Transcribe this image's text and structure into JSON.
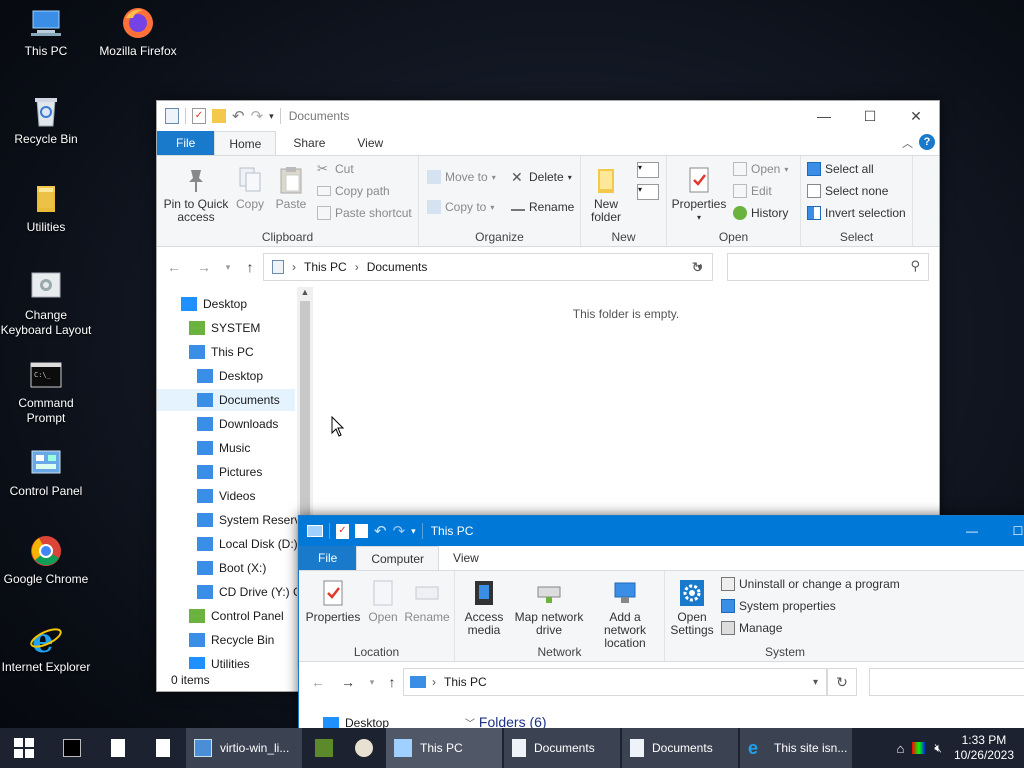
{
  "desktop": {
    "icons": [
      {
        "label": "This PC",
        "icon": "this-pc-icon"
      },
      {
        "label": "Mozilla Firefox",
        "icon": "firefox-icon"
      },
      {
        "label": "Recycle Bin",
        "icon": "recycle-bin-icon"
      },
      {
        "label": "Utilities",
        "icon": "folder-icon"
      },
      {
        "label": "Change Keyboard Layout",
        "icon": "keyboard-icon"
      },
      {
        "label": "Command Prompt",
        "icon": "cmd-icon"
      },
      {
        "label": "Control Panel",
        "icon": "control-panel-icon"
      },
      {
        "label": "Google Chrome",
        "icon": "chrome-icon"
      },
      {
        "label": "Internet Explorer",
        "icon": "ie-icon"
      }
    ]
  },
  "win1": {
    "title": "Documents",
    "tabs": {
      "file": "File",
      "home": "Home",
      "share": "Share",
      "view": "View"
    },
    "clipboard": {
      "pin": "Pin to Quick access",
      "copy": "Copy",
      "paste": "Paste",
      "cut": "Cut",
      "copy_path": "Copy path",
      "paste_shortcut": "Paste shortcut",
      "label": "Clipboard"
    },
    "organize": {
      "move_to": "Move to",
      "copy_to": "Copy to",
      "delete": "Delete",
      "rename": "Rename",
      "label": "Organize"
    },
    "new": {
      "new_folder": "New folder",
      "label": "New"
    },
    "open": {
      "properties": "Properties",
      "open": "Open",
      "edit": "Edit",
      "history": "History",
      "label": "Open"
    },
    "select": {
      "select_all": "Select all",
      "select_none": "Select none",
      "invert": "Invert selection",
      "label": "Select"
    },
    "breadcrumb": [
      "This PC",
      "Documents"
    ],
    "search_placeholder": "",
    "empty_message": "This folder is empty.",
    "status": "0 items",
    "tree": [
      {
        "label": "Desktop",
        "level": 0
      },
      {
        "label": "SYSTEM",
        "level": 1
      },
      {
        "label": "This PC",
        "level": 1
      },
      {
        "label": "Desktop",
        "level": 2
      },
      {
        "label": "Documents",
        "level": 2,
        "selected": true
      },
      {
        "label": "Downloads",
        "level": 2
      },
      {
        "label": "Music",
        "level": 2
      },
      {
        "label": "Pictures",
        "level": 2
      },
      {
        "label": "Videos",
        "level": 2
      },
      {
        "label": "System Reserve",
        "level": 2
      },
      {
        "label": "Local Disk (D:)",
        "level": 2
      },
      {
        "label": "Boot (X:)",
        "level": 2
      },
      {
        "label": "CD Drive (Y:) G",
        "level": 2
      },
      {
        "label": "Control Panel",
        "level": 1
      },
      {
        "label": "Recycle Bin",
        "level": 1
      },
      {
        "label": "Utilities",
        "level": 1
      }
    ]
  },
  "win2": {
    "title": "This PC",
    "tabs": {
      "file": "File",
      "computer": "Computer",
      "view": "View"
    },
    "location": {
      "properties": "Properties",
      "open": "Open",
      "rename": "Rename",
      "label": "Location"
    },
    "network": {
      "access_media": "Access media",
      "map_drive": "Map network drive",
      "add_location": "Add a network location",
      "label": "Network"
    },
    "system": {
      "open_settings": "Open Settings",
      "uninstall": "Uninstall or change a program",
      "sys_props": "System properties",
      "manage": "Manage",
      "label": "System"
    },
    "breadcrumb": [
      "This PC"
    ],
    "tree_first": "Desktop",
    "folders_header": "Folders (6)"
  },
  "taskbar": {
    "buttons": [
      {
        "label": "virtio-win_li...",
        "icon": "installer-icon"
      },
      {
        "label": "This PC",
        "icon": "this-pc-icon"
      },
      {
        "label": "Documents",
        "icon": "documents-icon"
      },
      {
        "label": "Documents",
        "icon": "documents-icon"
      },
      {
        "label": "This site isn...",
        "icon": "ie-icon"
      }
    ],
    "time": "1:33 PM",
    "date": "10/26/2023"
  },
  "colors": {
    "accent": "#1979ca",
    "taskbar": "#1c2230",
    "ribbon": "#f5f6f7",
    "title_active": "#0078d7"
  }
}
